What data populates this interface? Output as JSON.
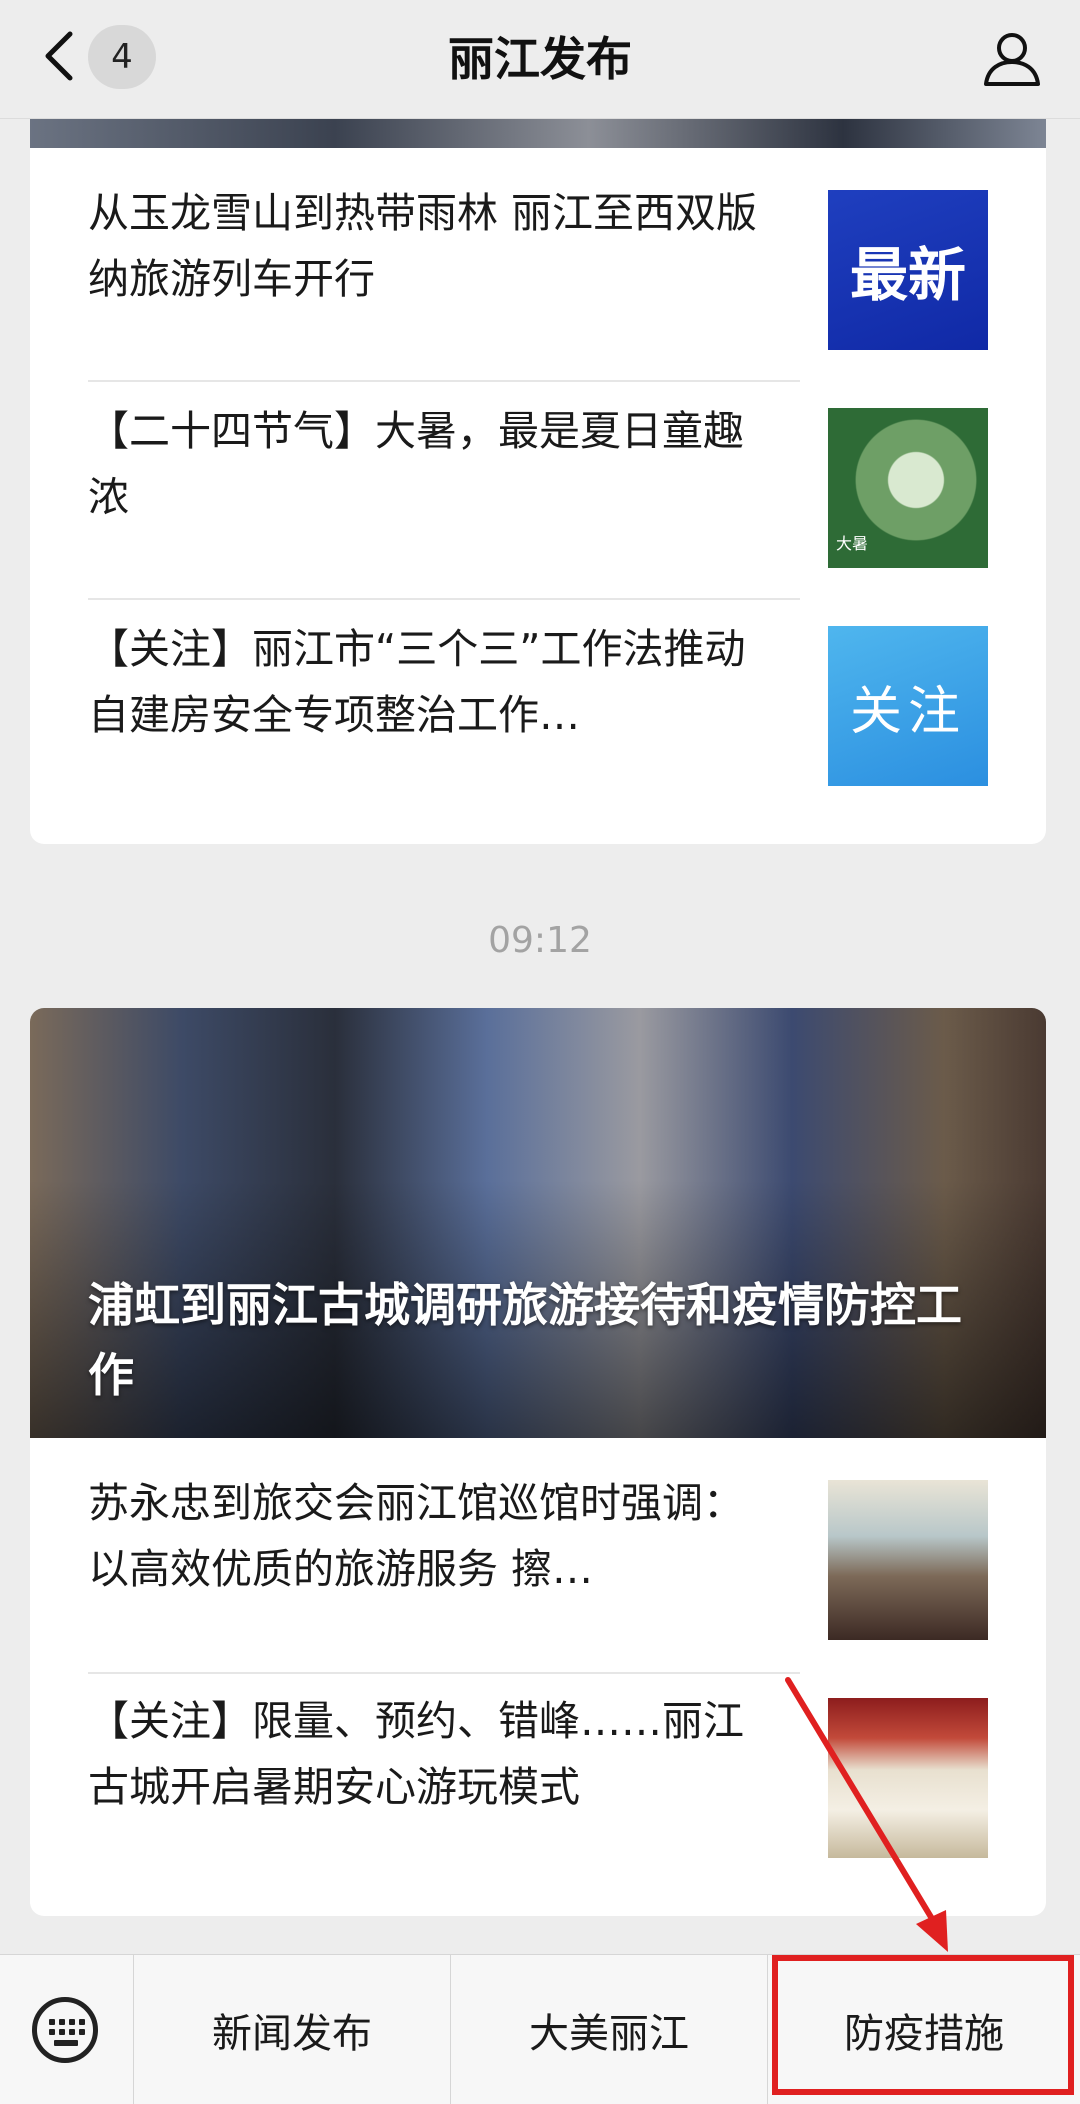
{
  "header": {
    "title": "丽江发布",
    "unread_badge": "4"
  },
  "feed": {
    "first_group": [
      {
        "title": "从玉龙雪山到热带雨林 丽江至西双版纳旅游列车开行",
        "thumb_text": "最新"
      },
      {
        "title": "【二十四节气】大暑，最是夏日童趣浓",
        "thumb_text": "大暑"
      },
      {
        "title": "【关注】丽江市“三个三”工作法推动自建房安全专项整治工作…",
        "thumb_text": "关注"
      }
    ],
    "timestamp": "09:12",
    "second_group": {
      "banner_title": "浦虹到丽江古城调研旅游接待和疫情防控工作",
      "items": [
        {
          "title": "苏永忠到旅交会丽江馆巡馆时强调：以高效优质的旅游服务 擦…"
        },
        {
          "title": "【关注】限量、预约、错峰……丽江古城开启暑期安心游玩模式"
        }
      ]
    }
  },
  "bottom_menu": {
    "items": [
      "新闻发布",
      "大美丽江",
      "防疫措施"
    ]
  },
  "colors": {
    "background": "#ededed",
    "highlight": "#e02020"
  }
}
